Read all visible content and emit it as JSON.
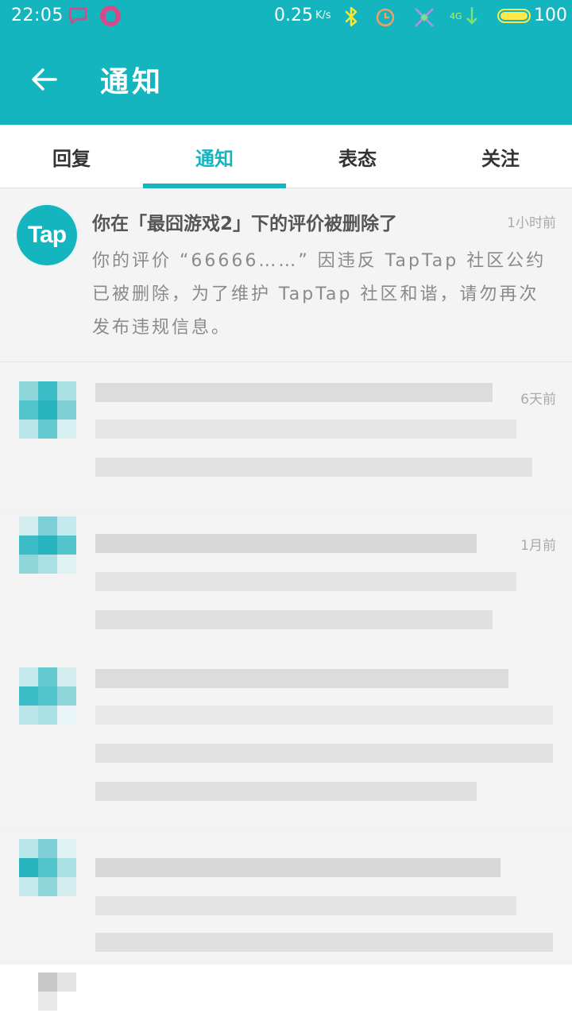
{
  "status_bar": {
    "time": "22:05",
    "speed": "0.25",
    "speed_unit": "K/s",
    "network": "4G",
    "battery": "100"
  },
  "header": {
    "title": "通知"
  },
  "tabs": [
    {
      "label": "回复"
    },
    {
      "label": "通知"
    },
    {
      "label": "表态"
    },
    {
      "label": "关注"
    }
  ],
  "notifications": [
    {
      "avatar_text": "Tap",
      "title": "你在「最囧游戏2」下的评价被删除了",
      "time": "1小时前",
      "body": "你的评价 “66666……” 因违反 TapTap 社区公约已被删除，为了维护 TapTap 社区和谐，请勿再次发布违规信息。"
    }
  ],
  "blurred_rows": [
    {
      "time": "6天前"
    },
    {
      "time": "1月前"
    }
  ],
  "colors": {
    "accent": "#14b5bf",
    "background": "#f2f2f2"
  }
}
